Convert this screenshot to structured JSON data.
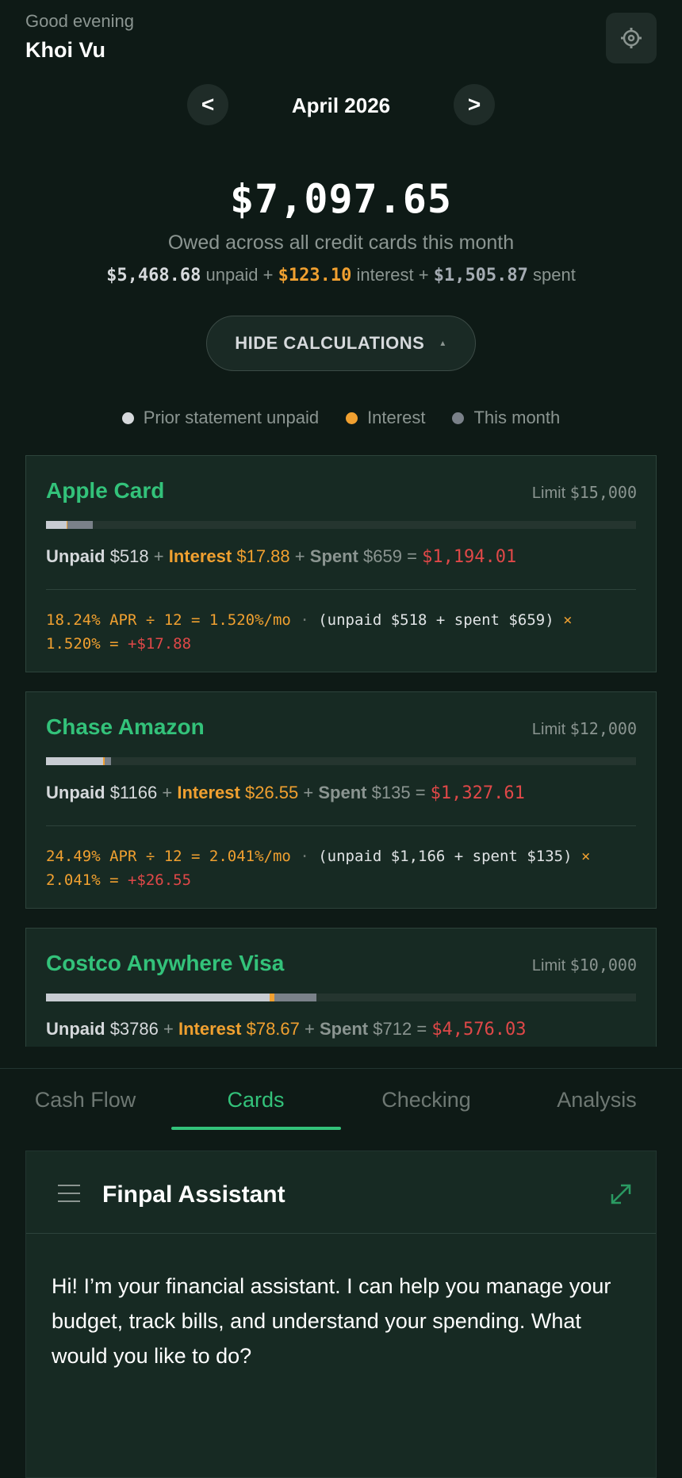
{
  "header": {
    "greeting": "Good evening",
    "user_name": "Khoi Vu",
    "settings_icon": "gear-icon"
  },
  "month_nav": {
    "prev_label": "<",
    "month": "April 2026",
    "next_label": ">"
  },
  "summary": {
    "total": "$7,097.65",
    "subtitle": "Owed across all credit cards this month",
    "unpaid": "$5,468.68",
    "unpaid_word": "unpaid +",
    "interest": "$123.10",
    "interest_word": "interest +",
    "spent": "$1,505.87",
    "spent_word": "spent",
    "toggle_label": "HIDE CALCULATIONS"
  },
  "legend": [
    {
      "label": "Prior statement unpaid",
      "color": "#d6d9dc"
    },
    {
      "label": "Interest",
      "color": "#f0a030"
    },
    {
      "label": "This month",
      "color": "#7a8189"
    }
  ],
  "colors": {
    "accent": "#33c27a",
    "interest": "#f0a030",
    "total": "#e04848",
    "unpaid": "#c8ccd2",
    "spent": "#7a8189"
  },
  "cards": [
    {
      "name": "Apple Card",
      "limit_label": "Limit",
      "limit": "$15,000",
      "bar": {
        "unpaid": 0.0345,
        "interest": 0.0012,
        "spent": 0.0439
      },
      "unpaid_label": "Unpaid",
      "unpaid": "$518",
      "interest_label": "Interest",
      "interest": "$17.88",
      "spent_label": "Spent",
      "spent": "$659",
      "total": "$1,194.01",
      "calc_rate": "18.24% APR ÷ 12 = 1.520%/mo",
      "calc_sep": "·",
      "calc_base": "(unpaid $518 + spent $659)",
      "calc_times": "×",
      "calc_line2": "1.520% =",
      "calc_result": "+$17.88"
    },
    {
      "name": "Chase Amazon",
      "limit_label": "Limit",
      "limit": "$12,000",
      "bar": {
        "unpaid": 0.0972,
        "interest": 0.0022,
        "spent": 0.0113
      },
      "unpaid_label": "Unpaid",
      "unpaid": "$1166",
      "interest_label": "Interest",
      "interest": "$26.55",
      "spent_label": "Spent",
      "spent": "$135",
      "total": "$1,327.61",
      "calc_rate": "24.49% APR ÷ 12 = 2.041%/mo",
      "calc_sep": "·",
      "calc_base": "(unpaid $1,166 + spent $135)",
      "calc_times": "×",
      "calc_line2": "2.041% =",
      "calc_result": "+$26.55"
    },
    {
      "name": "Costco Anywhere Visa",
      "limit_label": "Limit",
      "limit": "$10,000",
      "bar": {
        "unpaid": 0.3786,
        "interest": 0.0079,
        "spent": 0.0712
      },
      "unpaid_label": "Unpaid",
      "unpaid": "$3786",
      "interest_label": "Interest",
      "interest": "$78.67",
      "spent_label": "Spent",
      "spent": "$712",
      "total": "$4,576.03"
    }
  ],
  "tabs": [
    {
      "label": "Cash Flow",
      "active": false
    },
    {
      "label": "Cards",
      "active": true
    },
    {
      "label": "Checking",
      "active": false
    },
    {
      "label": "Analysis",
      "active": false
    }
  ],
  "assistant": {
    "title": "Finpal Assistant",
    "message": "Hi! I’m your financial assistant. I can help you manage your budget, track bills, and understand your spending. What would you like to do?"
  }
}
